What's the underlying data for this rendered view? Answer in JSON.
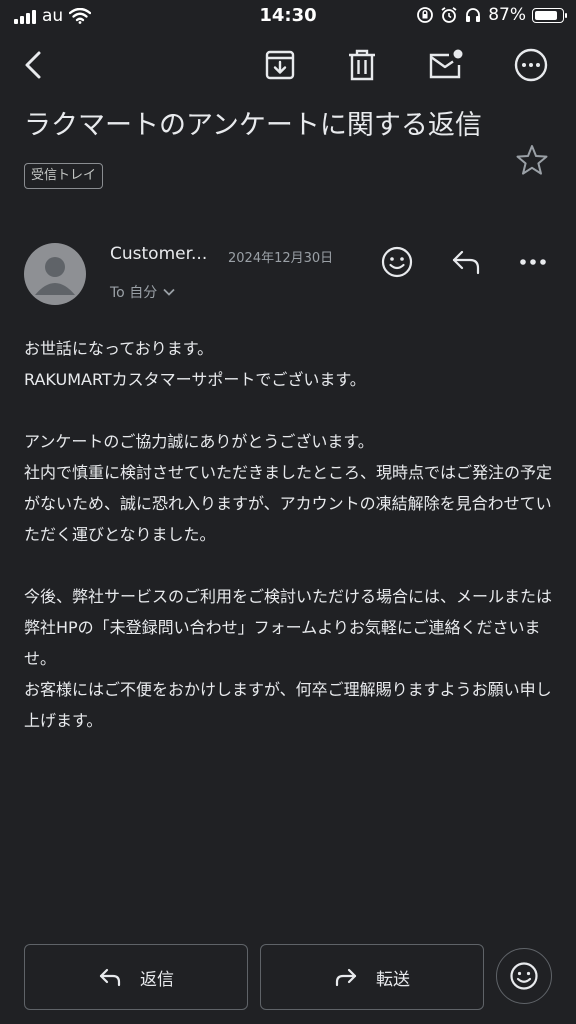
{
  "status_bar": {
    "carrier": "au",
    "time": "14:30",
    "battery": "87%",
    "battery_level": 0.87
  },
  "toolbar": {
    "back": "back-icon",
    "archive": "archive-icon",
    "delete": "trash-icon",
    "mark_unread": "mail-unread-icon",
    "more": "more-icon"
  },
  "email": {
    "subject": "ラクマートのアンケートに関する返信",
    "label": "受信トレイ",
    "sender": "Customer...",
    "date": "2024年12月30日",
    "recipient": "To 自分",
    "body": [
      "お世話になっております。",
      "RAKUMARTカスタマーサポートでございます。",
      "",
      "アンケートのご協力誠にありがとうございます。",
      "社内で慎重に検討させていただきましたところ、現時点ではご発注の予定がないため、誠に恐れ入りますが、アカウントの凍結解除を見合わせていただく運びとなりました。",
      "",
      "今後、弊社サービスのご利用をご検討いただける場合には、メールまたは弊社HPの「未登録問い合わせ」フォームよりお気軽にご連絡くださいませ。",
      "お客様にはご不便をおかけしますが、何卒ご理解賜りますようお願い申し上げます。"
    ]
  },
  "actions": {
    "reply": "返信",
    "forward": "転送"
  },
  "colors": {
    "background": "#202124",
    "text": "#e8eaed",
    "muted": "#9aa0a6",
    "border": "#5f6368"
  }
}
